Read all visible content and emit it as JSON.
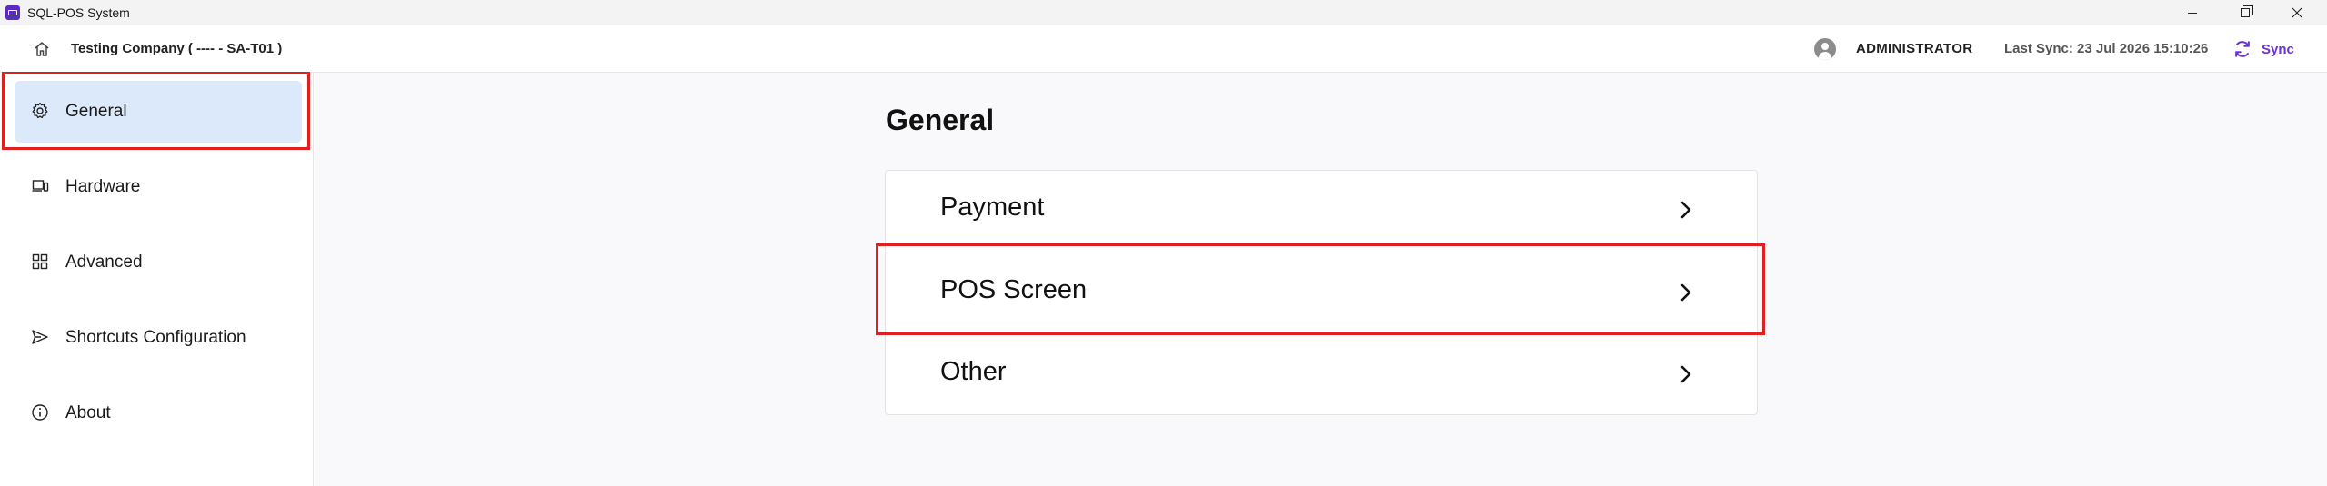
{
  "window": {
    "title": "SQL-POS System"
  },
  "header": {
    "company": "Testing Company ( ---- - SA-T01 )",
    "user": "ADMINISTRATOR",
    "last_sync": "Last Sync: 23 Jul 2026 15:10:26",
    "sync_label": "Sync",
    "accent_color": "#6a33d6"
  },
  "sidebar": {
    "items": [
      {
        "label": "General",
        "icon": "gear-icon",
        "active": true
      },
      {
        "label": "Hardware",
        "icon": "devices-icon"
      },
      {
        "label": "Advanced",
        "icon": "grid-icon"
      },
      {
        "label": "Shortcuts Configuration",
        "icon": "send-icon"
      },
      {
        "label": "About",
        "icon": "info-icon"
      }
    ]
  },
  "main": {
    "title": "General",
    "rows": [
      {
        "label": "Payment"
      },
      {
        "label": "POS Screen"
      },
      {
        "label": "Other"
      }
    ]
  }
}
